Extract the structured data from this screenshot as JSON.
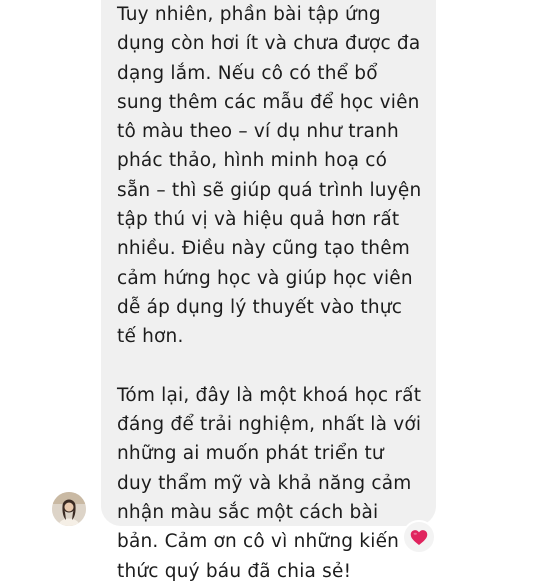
{
  "message": {
    "paragraph_1": "Tuy nhiên, phần bài tập ứng dụng còn hơi ít và chưa được đa dạng lắm. Nếu cô có thể bổ sung thêm các mẫu để học viên tô màu theo – ví dụ như tranh phác thảo, hình minh hoạ có sẵn – thì sẽ giúp quá trình luyện tập thú vị và hiệu quả hơn rất nhiều. Điều này cũng tạo thêm cảm hứng học và giúp học viên dễ áp dụng lý thuyết vào thực tế hơn.",
    "paragraph_2": "Tóm lại, đây là một khoá học rất đáng để trải nghiệm, nhất là với những ai muốn phát triển tư duy thẩm mỹ và khả năng cảm nhận màu sắc một cách bài bản. Cảm ơn cô vì những kiến thức quý báu đã chia sẻ!"
  },
  "sender": {
    "avatar_icon": "user-avatar-photo"
  },
  "reaction": {
    "icon": "red-heart-icon",
    "color": "#e0245e"
  },
  "colors": {
    "bubble_background": "#f0f0f0",
    "text": "#1c1c1c",
    "page_background": "#ffffff"
  }
}
